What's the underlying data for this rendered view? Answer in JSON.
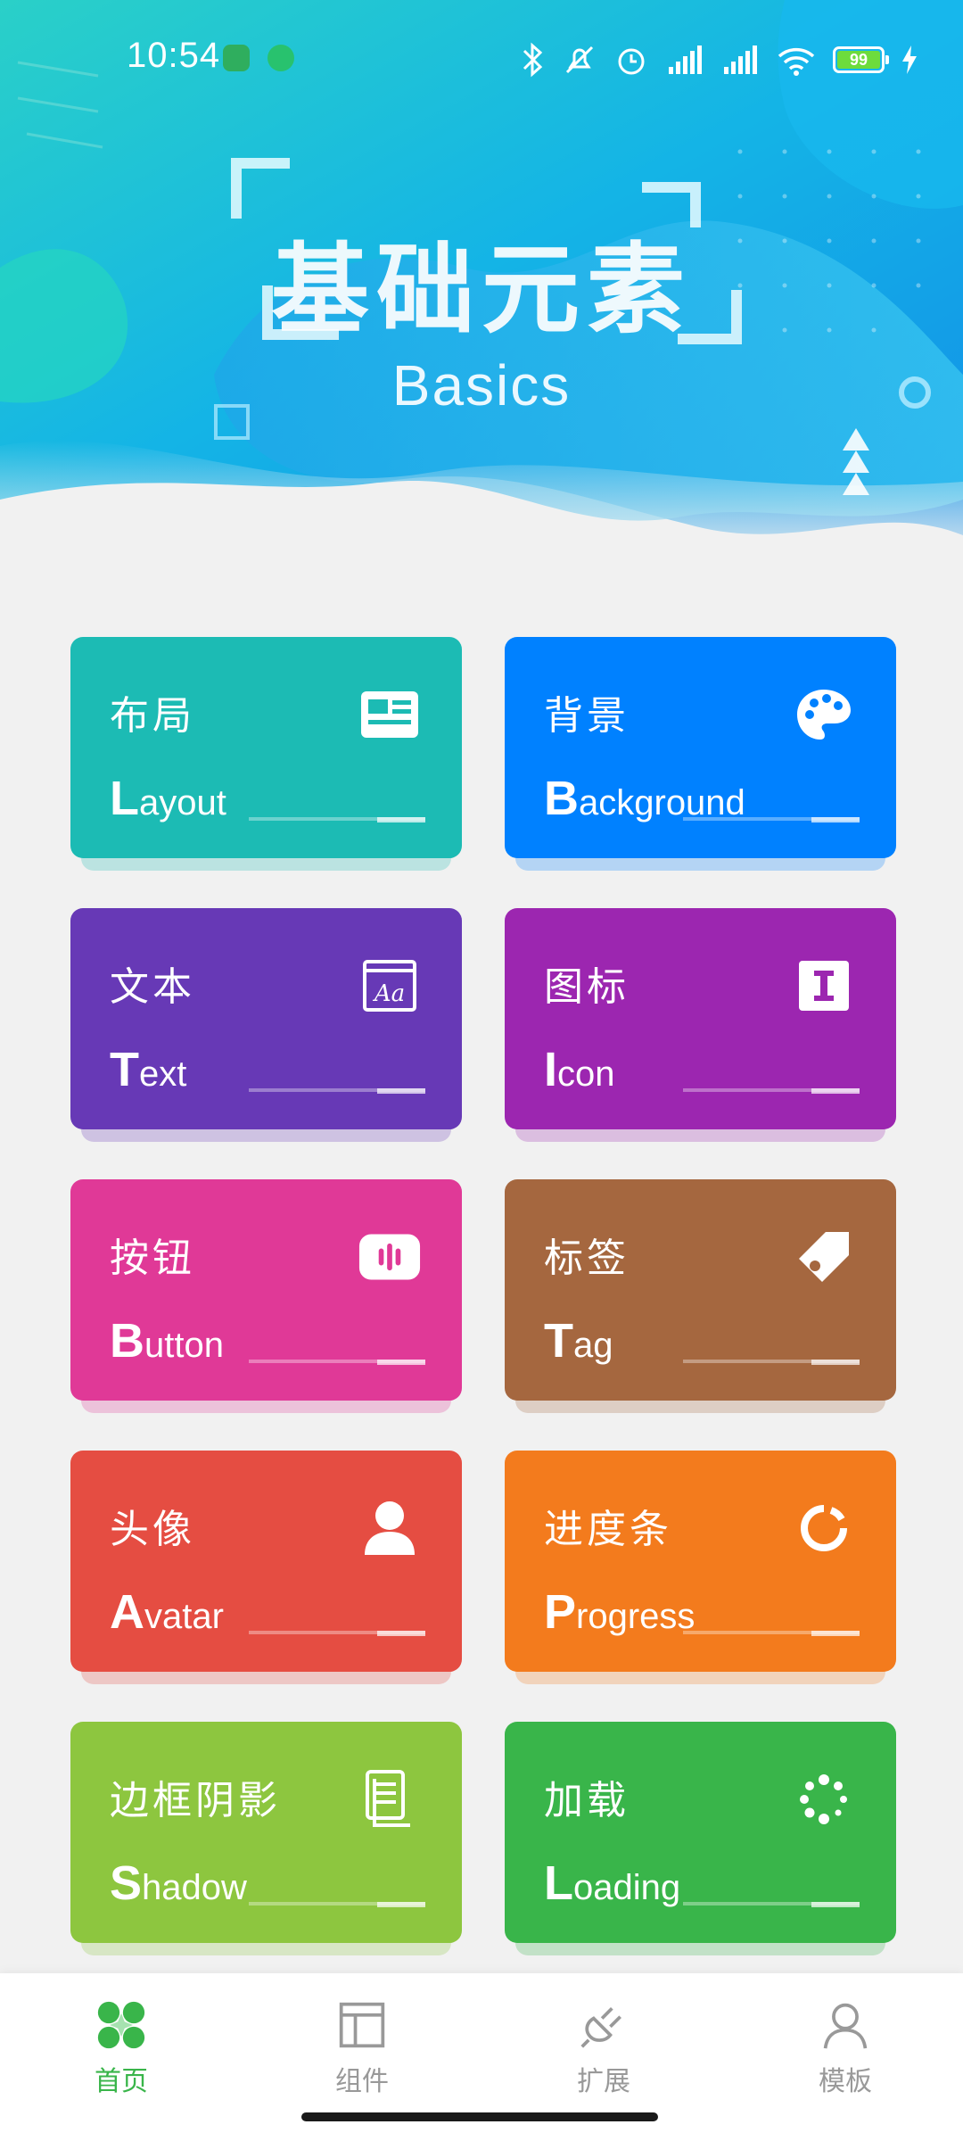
{
  "status_bar": {
    "time": "10:54",
    "battery_level": "99",
    "icons": [
      "bluetooth-icon",
      "mute-icon",
      "alarm-icon",
      "signal-hd-icon",
      "signal-hd-icon",
      "wifi-icon",
      "battery-icon",
      "charging-icon"
    ]
  },
  "header": {
    "title_cn": "基础元素",
    "title_en": "Basics"
  },
  "cards": [
    {
      "cn": "布局",
      "en_first": "L",
      "en_rest": "ayout",
      "color": "#1cbbb4",
      "icon": "newspaper-icon"
    },
    {
      "cn": "背景",
      "en_first": "B",
      "en_rest": "ackground",
      "color": "#0081ff",
      "icon": "palette-icon"
    },
    {
      "cn": "文本",
      "en_first": "T",
      "en_rest": "ext",
      "color": "#6739b6",
      "icon": "text-font-icon"
    },
    {
      "cn": "图标",
      "en_first": "I",
      "en_rest": "con",
      "color": "#9c26b0",
      "icon": "icon-box-icon"
    },
    {
      "cn": "按钮",
      "en_first": "B",
      "en_rest": "utton",
      "color": "#e03997",
      "icon": "button-icon"
    },
    {
      "cn": "标签",
      "en_first": "T",
      "en_rest": "ag",
      "color": "#a5673f",
      "icon": "tag-icon"
    },
    {
      "cn": "头像",
      "en_first": "A",
      "en_rest": "vatar",
      "color": "#e54d42",
      "icon": "user-icon"
    },
    {
      "cn": "进度条",
      "en_first": "P",
      "en_rest": "rogress",
      "color": "#f37b1d",
      "icon": "progress-icon"
    },
    {
      "cn": "边框阴影",
      "en_first": "S",
      "en_rest": "hadow",
      "color": "#8dc63f",
      "icon": "copy-icon"
    },
    {
      "cn": "加载",
      "en_first": "L",
      "en_rest": "oading",
      "color": "#39b54a",
      "icon": "loading-icon"
    }
  ],
  "tabbar": {
    "tabs": [
      {
        "label": "首页",
        "icon": "home-grid-icon",
        "active": true
      },
      {
        "label": "组件",
        "icon": "layout-icon",
        "active": false
      },
      {
        "label": "扩展",
        "icon": "plugin-icon",
        "active": false
      },
      {
        "label": "模板",
        "icon": "person-icon",
        "active": false
      }
    ],
    "active_color": "#39b54a",
    "inactive_color": "#999999"
  }
}
